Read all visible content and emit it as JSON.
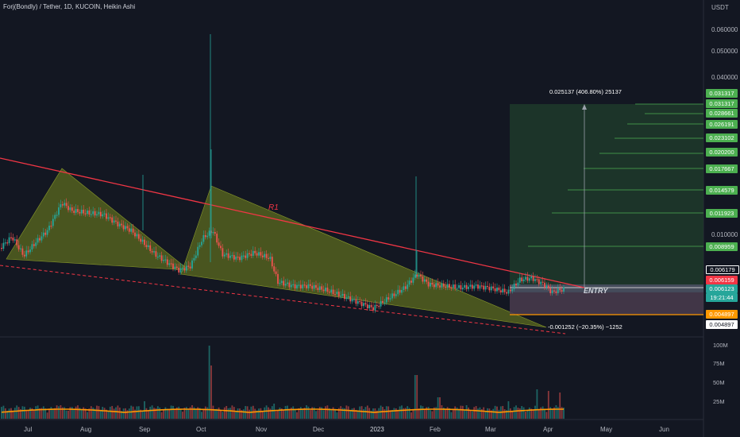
{
  "header": {
    "title": "Forj(Bondly) / Tether, 1D, KUCOIN, Heikin Ashi",
    "currency": "USDT"
  },
  "colors": {
    "background": "#131722",
    "up": "#26a69a",
    "down": "#ef5350",
    "target_green": "#4caf50",
    "stop": "#ff9800",
    "resistance": "#f23645",
    "triangle_fill": "#5c6b1f"
  },
  "price_axis": {
    "labels": [
      "0.060000",
      "0.050000",
      "0.040000",
      "0.010000"
    ],
    "tags": [
      {
        "text": "0.031317",
        "color": "#4caf50"
      },
      {
        "text": "0.031317",
        "color": "#4caf50"
      },
      {
        "text": "0.028661",
        "color": "#4caf50"
      },
      {
        "text": "0.026191",
        "color": "#4caf50"
      },
      {
        "text": "0.023102",
        "color": "#4caf50"
      },
      {
        "text": "0.020200",
        "color": "#4caf50"
      },
      {
        "text": "0.017667",
        "color": "#4caf50"
      },
      {
        "text": "0.014579",
        "color": "#4caf50"
      },
      {
        "text": "0.011923",
        "color": "#4caf50"
      },
      {
        "text": "0.008959",
        "color": "#4caf50"
      },
      {
        "text": "0.006179",
        "color": "#131722"
      },
      {
        "text": "0.006159",
        "color": "#f23645"
      },
      {
        "text": "0.006123",
        "color": "#26a69a"
      },
      {
        "text": "19:21:44",
        "color": "#26a69a"
      },
      {
        "text": "0.004897",
        "color": "#ff9800"
      },
      {
        "text": "0.004897",
        "color": "#ffffff"
      }
    ]
  },
  "volume_axis": {
    "labels": [
      "100M",
      "75M",
      "50M",
      "25M"
    ]
  },
  "time_axis": {
    "labels": [
      "Jul",
      "Aug",
      "Sep",
      "Oct",
      "Nov",
      "Dec",
      "2023",
      "Feb",
      "Mar",
      "Apr",
      "May",
      "Jun"
    ]
  },
  "annotations": {
    "resistance_label": "R1",
    "entry_label": "ENTRY",
    "target_text": "0.025137 (406.80%) 25137",
    "stop_text": "-0.001252 (−20.35%) −1252"
  },
  "chart_data": {
    "type": "candlestick",
    "title": "Forj(Bondly) / Tether, 1D, KUCOIN, Heikin Ashi",
    "x_range": [
      "Jul",
      "Jun"
    ],
    "target_levels": [
      0.031317,
      0.028661,
      0.026191,
      0.023102,
      0.0202,
      0.017667,
      0.014579,
      0.011923,
      0.008959
    ],
    "entry": 0.006179,
    "last_price": 0.006123,
    "stop": 0.004897,
    "profit": 0.025137,
    "profit_pct": 406.8,
    "risk": -0.001252,
    "risk_pct": -20.35,
    "y_axis_ticks": [
      0.06,
      0.05,
      0.04,
      0.01
    ],
    "volume_ticks": [
      "100M",
      "75M",
      "50M",
      "25M"
    ]
  }
}
